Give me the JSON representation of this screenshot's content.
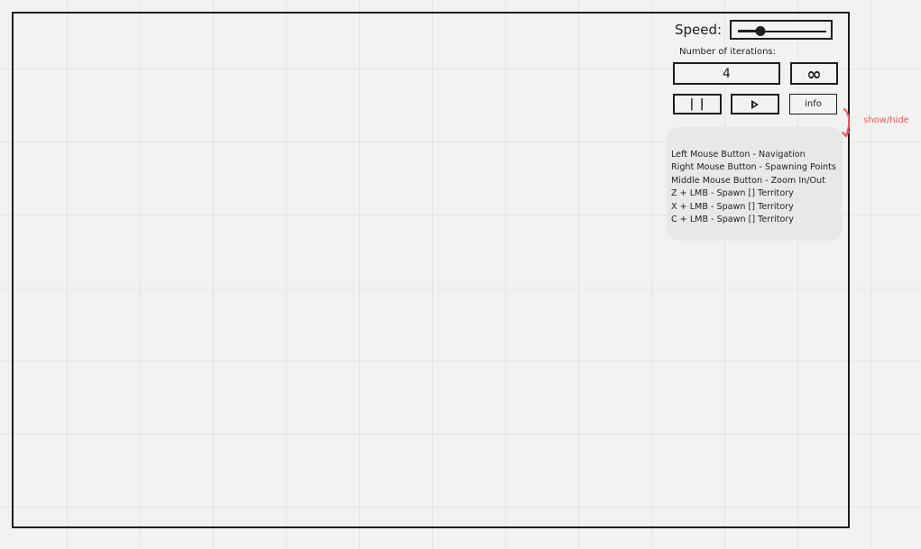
{
  "controls": {
    "speed_label": "Speed:",
    "speed_value": 0.25,
    "iterations_label": "Number of iterations:",
    "iterations_value": "4",
    "infinite_label": "∞",
    "pause_label": "| |",
    "info_label": "info"
  },
  "annotation": {
    "toggle_note": "show/hide",
    "color": "#f05a5a"
  },
  "info_panel": {
    "lines": [
      "Left Mouse Button - Navigation",
      "Right Mouse Button - Spawning Points",
      "Middle Mouse Button - Zoom In/Out",
      "Z + LMB - Spawn [] Territory",
      "X + LMB - Spawn [] Territory",
      "C + LMB - Spawn [] Territory"
    ]
  }
}
